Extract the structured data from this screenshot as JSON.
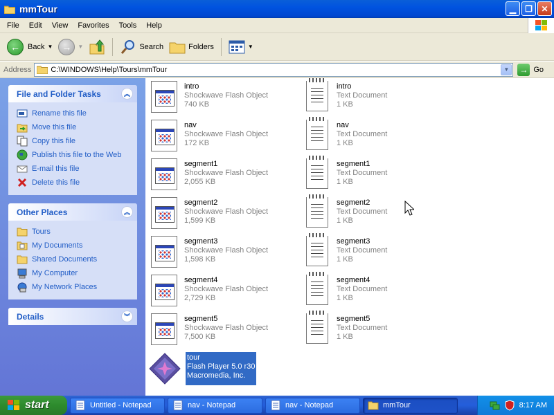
{
  "window": {
    "title": "mmTour"
  },
  "menu": [
    "File",
    "Edit",
    "View",
    "Favorites",
    "Tools",
    "Help"
  ],
  "toolbar": {
    "back": "Back",
    "search": "Search",
    "folders": "Folders"
  },
  "address": {
    "label": "Address",
    "path": "C:\\WINDOWS\\Help\\Tours\\mmTour",
    "go": "Go"
  },
  "left": {
    "tasks": {
      "title": "File and Folder Tasks",
      "items": [
        {
          "label": "Rename this file",
          "icon": "rename-icon"
        },
        {
          "label": "Move this file",
          "icon": "move-icon"
        },
        {
          "label": "Copy this file",
          "icon": "copy-icon"
        },
        {
          "label": "Publish this file to the Web",
          "icon": "globe-icon"
        },
        {
          "label": "E-mail this file",
          "icon": "email-icon"
        },
        {
          "label": "Delete this file",
          "icon": "delete-icon"
        }
      ]
    },
    "places": {
      "title": "Other Places",
      "items": [
        {
          "label": "Tours",
          "icon": "folder-icon"
        },
        {
          "label": "My Documents",
          "icon": "my-documents-icon"
        },
        {
          "label": "Shared Documents",
          "icon": "shared-documents-icon"
        },
        {
          "label": "My Computer",
          "icon": "my-computer-icon"
        },
        {
          "label": "My Network Places",
          "icon": "network-icon"
        }
      ]
    },
    "details": {
      "title": "Details"
    }
  },
  "files": [
    {
      "name": "intro",
      "type": "Shockwave Flash Object",
      "size": "740 KB",
      "icon": "flash-object-icon"
    },
    {
      "name": "intro",
      "type": "Text Document",
      "size": "1 KB",
      "icon": "text-document-icon"
    },
    {
      "name": "nav",
      "type": "Shockwave Flash Object",
      "size": "172 KB",
      "icon": "flash-object-icon"
    },
    {
      "name": "nav",
      "type": "Text Document",
      "size": "1 KB",
      "icon": "text-document-icon"
    },
    {
      "name": "segment1",
      "type": "Shockwave Flash Object",
      "size": "2,055 KB",
      "icon": "flash-object-icon"
    },
    {
      "name": "segment1",
      "type": "Text Document",
      "size": "1 KB",
      "icon": "text-document-icon"
    },
    {
      "name": "segment2",
      "type": "Shockwave Flash Object",
      "size": "1,599 KB",
      "icon": "flash-object-icon"
    },
    {
      "name": "segment2",
      "type": "Text Document",
      "size": "1 KB",
      "icon": "text-document-icon"
    },
    {
      "name": "segment3",
      "type": "Shockwave Flash Object",
      "size": "1,598 KB",
      "icon": "flash-object-icon"
    },
    {
      "name": "segment3",
      "type": "Text Document",
      "size": "1 KB",
      "icon": "text-document-icon"
    },
    {
      "name": "segment4",
      "type": "Shockwave Flash Object",
      "size": "2,729 KB",
      "icon": "flash-object-icon"
    },
    {
      "name": "segment4",
      "type": "Text Document",
      "size": "1 KB",
      "icon": "text-document-icon"
    },
    {
      "name": "segment5",
      "type": "Shockwave Flash Object",
      "size": "7,500 KB",
      "icon": "flash-object-icon"
    },
    {
      "name": "segment5",
      "type": "Text Document",
      "size": "1 KB",
      "icon": "text-document-icon"
    },
    {
      "name": "tour",
      "type": "Flash Player 5.0 r30",
      "size": "Macromedia, Inc.",
      "icon": "flash-player-icon",
      "selected": true
    }
  ],
  "taskbar": {
    "start": "start",
    "buttons": [
      {
        "label": "Untitled - Notepad",
        "icon": "notepad-icon"
      },
      {
        "label": "nav - Notepad",
        "icon": "notepad-icon"
      },
      {
        "label": "nav - Notepad",
        "icon": "notepad-icon"
      },
      {
        "label": "mmTour",
        "icon": "folder-icon",
        "active": true
      }
    ],
    "clock": "8:17 AM"
  },
  "colors": {
    "titlebar": "#0053e0",
    "taskpane_link": "#215dc6",
    "selection": "#316ac5"
  }
}
